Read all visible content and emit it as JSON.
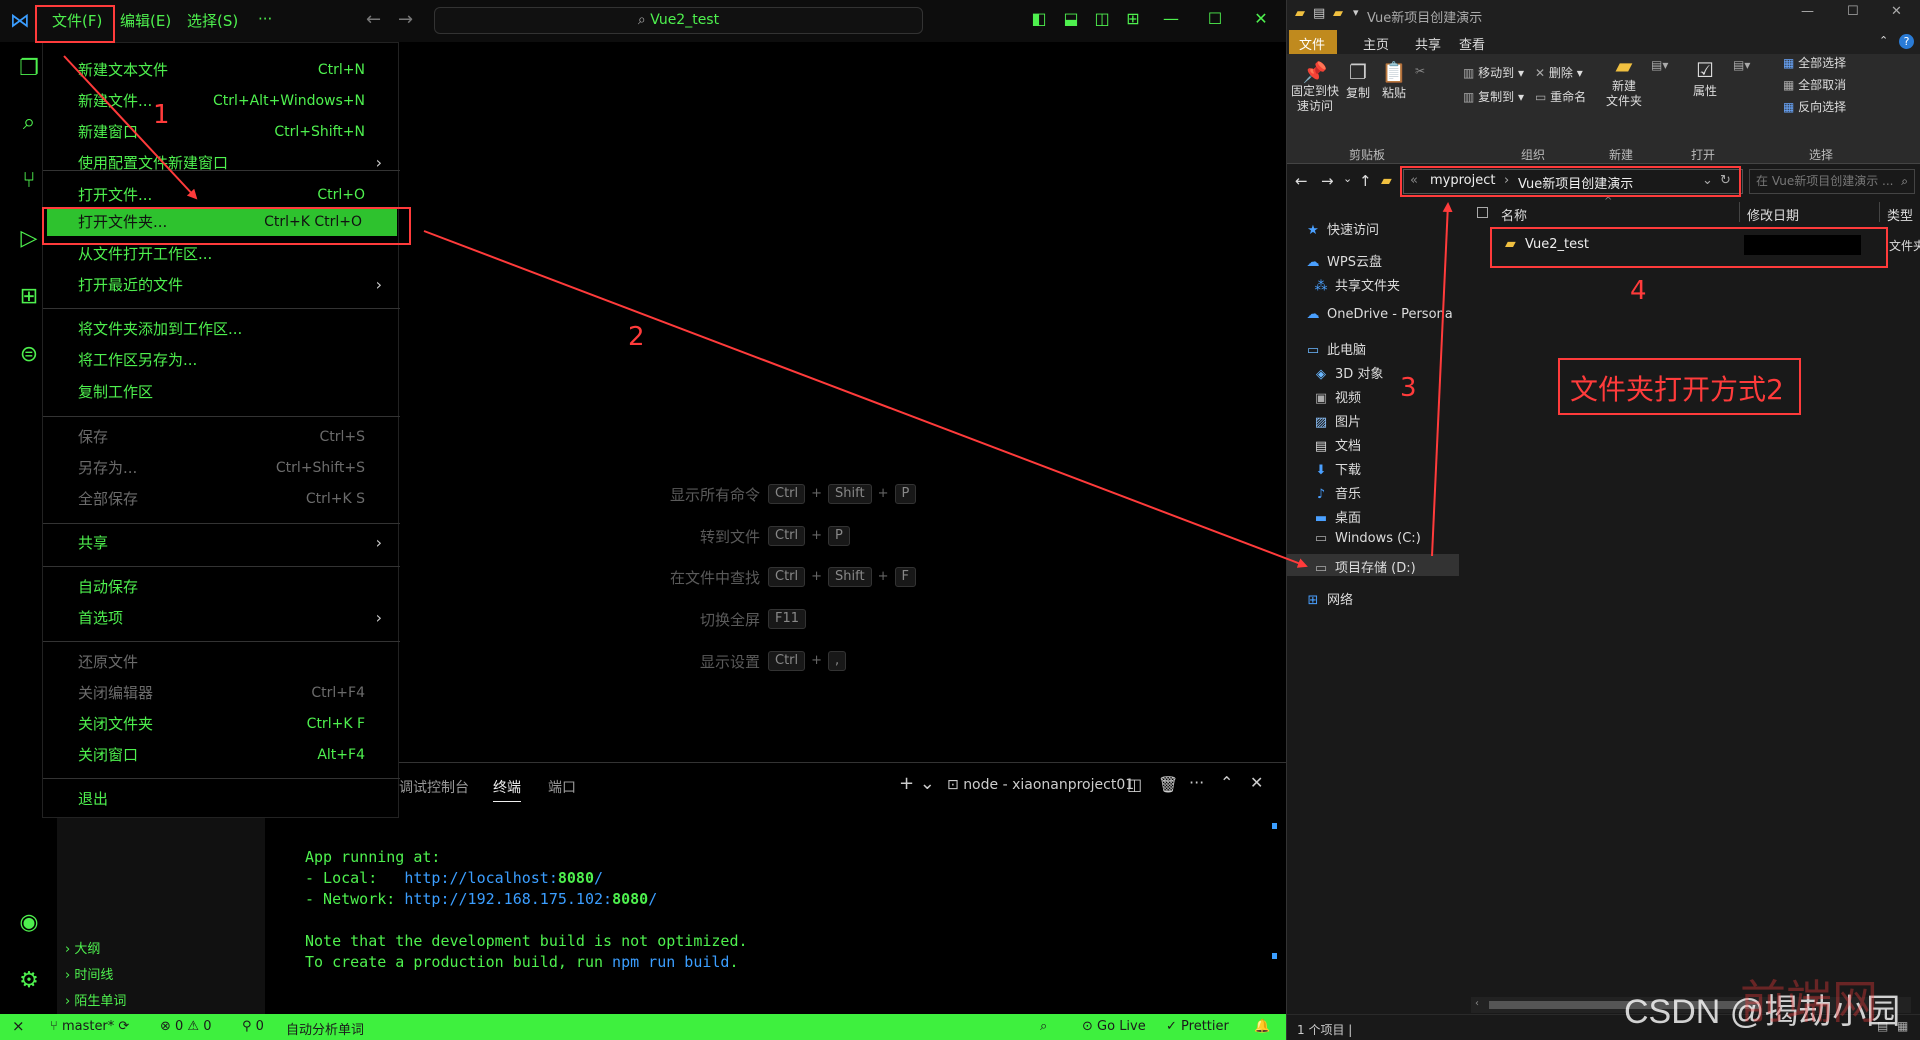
{
  "vscode": {
    "menubar": {
      "file": "文件(F)",
      "edit": "编辑(E)",
      "select": "选择(S)",
      "more": "···"
    },
    "command_center": "Vue2_test",
    "file_menu": {
      "items": [
        {
          "label": "新建文本文件",
          "shortcut": "Ctrl+N"
        },
        {
          "label": "新建文件...",
          "shortcut": "Ctrl+Alt+Windows+N"
        },
        {
          "label": "新建窗口",
          "shortcut": "Ctrl+Shift+N"
        },
        {
          "label": "使用配置文件新建窗口",
          "shortcut": "›"
        },
        {
          "label": "打开文件...",
          "shortcut": "Ctrl+O"
        },
        {
          "label": "打开文件夹...",
          "shortcut": "Ctrl+K Ctrl+O"
        },
        {
          "label": "从文件打开工作区...",
          "shortcut": ""
        },
        {
          "label": "打开最近的文件",
          "shortcut": "›"
        },
        {
          "label": "将文件夹添加到工作区...",
          "shortcut": ""
        },
        {
          "label": "将工作区另存为...",
          "shortcut": ""
        },
        {
          "label": "复制工作区",
          "shortcut": ""
        },
        {
          "label": "保存",
          "shortcut": "Ctrl+S"
        },
        {
          "label": "另存为...",
          "shortcut": "Ctrl+Shift+S"
        },
        {
          "label": "全部保存",
          "shortcut": "Ctrl+K S"
        },
        {
          "label": "共享",
          "shortcut": "›"
        },
        {
          "label": "自动保存",
          "shortcut": ""
        },
        {
          "label": "首选项",
          "shortcut": "›"
        },
        {
          "label": "还原文件",
          "shortcut": ""
        },
        {
          "label": "关闭编辑器",
          "shortcut": "Ctrl+F4"
        },
        {
          "label": "关闭文件夹",
          "shortcut": "Ctrl+K F"
        },
        {
          "label": "关闭窗口",
          "shortcut": "Alt+F4"
        },
        {
          "label": "退出",
          "shortcut": ""
        }
      ]
    },
    "hints": [
      {
        "label": "显示所有命令",
        "keys": [
          "Ctrl",
          "Shift",
          "P"
        ]
      },
      {
        "label": "转到文件",
        "keys": [
          "Ctrl",
          "P"
        ]
      },
      {
        "label": "在文件中查找",
        "keys": [
          "Ctrl",
          "Shift",
          "F"
        ]
      },
      {
        "label": "切换全屏",
        "keys": [
          "F11"
        ]
      },
      {
        "label": "显示设置",
        "keys": [
          "Ctrl",
          ","
        ]
      }
    ],
    "panel": {
      "tabs": [
        "调试控制台",
        "终端",
        "端口"
      ],
      "terminal_name": "node - xiaonanproject01",
      "lines": [
        "App running at:",
        "- Local:   http://localhost:8080/",
        "- Network: http://192.168.175.102:8080/",
        "",
        "Note that the development build is not optimized.",
        "To create a production build, run npm run build."
      ]
    },
    "sidebar_sections": [
      "大纲",
      "时间线",
      "陌生单词"
    ],
    "status": {
      "branch": "master*",
      "problems": "⊗ 0 ⚠ 0",
      "ports": "0",
      "analysis": "自动分析单词",
      "golive": "Go Live",
      "prettier": "Prettier"
    }
  },
  "explorer": {
    "title": "Vue新项目创建演示",
    "ribbon_tabs": [
      "文件",
      "主页",
      "共享",
      "查看"
    ],
    "ribbon": {
      "pin": "固定到快\n速访问",
      "copy": "复制",
      "paste": "粘贴",
      "move_to": "移动到",
      "copy_to": "复制到",
      "delete": "删除",
      "rename": "重命名",
      "new_folder": "新建\n文件夹",
      "properties": "属性",
      "select_all": "全部选择",
      "select_none": "全部取消",
      "invert": "反向选择",
      "groups": [
        "剪贴板",
        "组织",
        "新建",
        "打开",
        "选择"
      ]
    },
    "address": {
      "prefix": "«",
      "crumb1": "myproject",
      "crumb2": "Vue新项目创建演示"
    },
    "search_placeholder": "在 Vue新项目创建演示 ...",
    "nav": [
      {
        "label": "快速访问",
        "icon": "star-icon"
      },
      {
        "label": "WPS云盘",
        "icon": "cloud-icon"
      },
      {
        "label": "共享文件夹",
        "icon": "share-icon"
      },
      {
        "label": "OneDrive - Persona",
        "icon": "cloud-icon"
      },
      {
        "label": "此电脑",
        "icon": "pc-icon"
      },
      {
        "label": "3D 对象",
        "icon": "cube-icon"
      },
      {
        "label": "视频",
        "icon": "video-icon"
      },
      {
        "label": "图片",
        "icon": "image-icon"
      },
      {
        "label": "文档",
        "icon": "doc-icon"
      },
      {
        "label": "下载",
        "icon": "download-icon"
      },
      {
        "label": "音乐",
        "icon": "music-icon"
      },
      {
        "label": "桌面",
        "icon": "desktop-icon"
      },
      {
        "label": "Windows (C:)",
        "icon": "drive-icon"
      },
      {
        "label": "项目存储 (D:)",
        "icon": "drive-icon"
      },
      {
        "label": "网络",
        "icon": "network-icon"
      }
    ],
    "columns": [
      "名称",
      "修改日期",
      "类型"
    ],
    "files": [
      {
        "name": "Vue2_test",
        "type": "文件夹"
      }
    ],
    "status": "1 个项目"
  },
  "annotations": {
    "n1": "1",
    "n2": "2",
    "n3": "3",
    "n4": "4",
    "caption": "文件夹打开方式2",
    "watermark": "CSDN @揭劫小园",
    "watermark2": "前端网"
  }
}
